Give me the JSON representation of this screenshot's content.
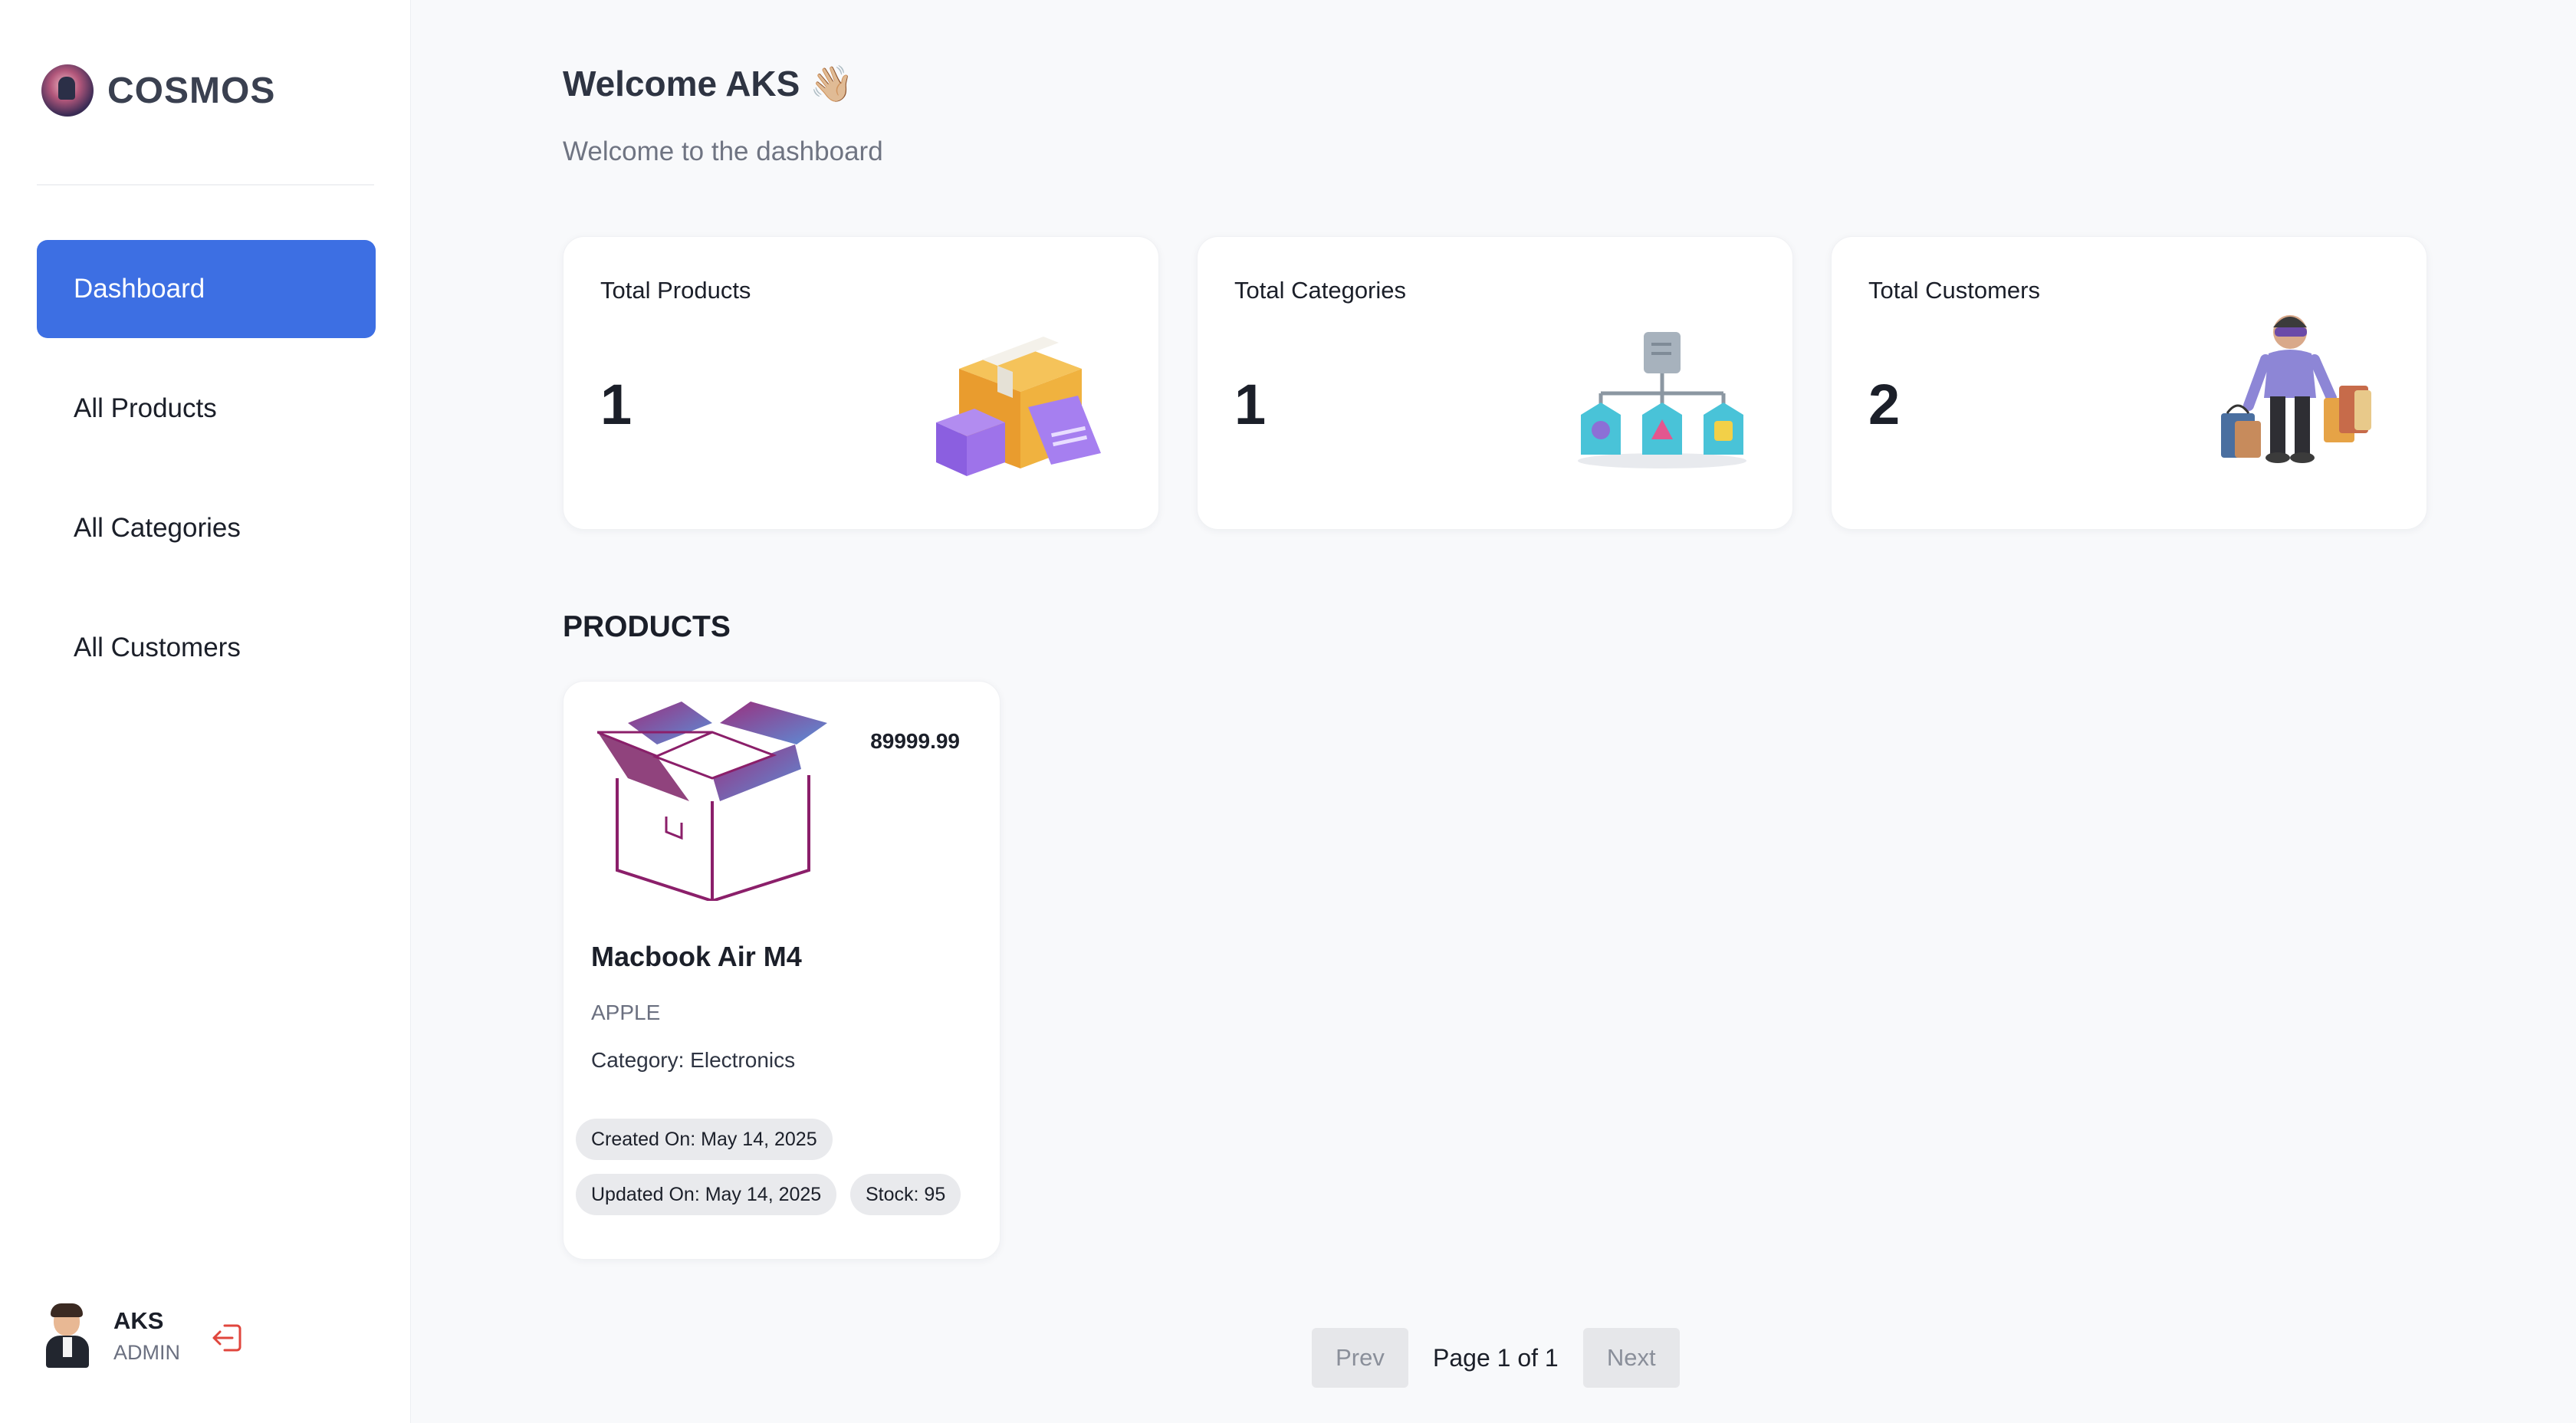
{
  "brand": {
    "name": "COSMOS",
    "logo_icon": "cosmos-logo-icon"
  },
  "sidebar": {
    "items": [
      {
        "label": "Dashboard",
        "active": true
      },
      {
        "label": "All Products",
        "active": false
      },
      {
        "label": "All Categories",
        "active": false
      },
      {
        "label": "All Customers",
        "active": false
      }
    ]
  },
  "user": {
    "name": "AKS",
    "role": "ADMIN",
    "avatar_icon": "user-avatar-icon",
    "logout_icon": "logout-icon"
  },
  "header": {
    "title": "Welcome AKS 👋🏼",
    "subtitle": "Welcome to the dashboard"
  },
  "stats": [
    {
      "label": "Total Products",
      "value": "1",
      "icon": "product-box-icon"
    },
    {
      "label": "Total Categories",
      "value": "1",
      "icon": "category-tree-icon"
    },
    {
      "label": "Total Customers",
      "value": "2",
      "icon": "customer-shopping-icon"
    }
  ],
  "products_section": {
    "title": "PRODUCTS",
    "items": [
      {
        "name": "Macbook Air M4",
        "price": "89999.99",
        "brand": "APPLE",
        "category": "Category: Electronics",
        "created": "Created On: May 14, 2025",
        "updated": "Updated On: May 14, 2025",
        "stock": "Stock: 95",
        "image_icon": "open-box-icon"
      }
    ]
  },
  "pagination": {
    "prev": "Prev",
    "info": "Page 1 of 1",
    "next": "Next"
  },
  "colors": {
    "accent": "#3d6fe3",
    "background": "#f8f9fb",
    "card": "#ffffff",
    "pill": "#e9eaed"
  }
}
